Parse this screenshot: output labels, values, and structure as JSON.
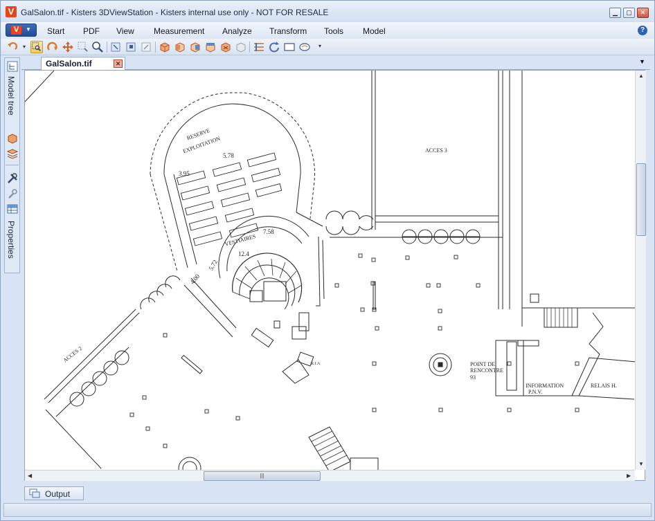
{
  "window": {
    "title": "GalSalon.tif - Kisters 3DViewStation - Kisters internal use only - NOT FOR RESALE",
    "logo_letter": "V"
  },
  "menu": {
    "items": [
      "Start",
      "PDF",
      "View",
      "Measurement",
      "Analyze",
      "Transform",
      "Tools",
      "Model"
    ],
    "help": "?"
  },
  "sidebar": {
    "model_tree_label": "Model tree",
    "properties_label": "Properties"
  },
  "document": {
    "tab_label": "GalSalon.tif"
  },
  "drawing": {
    "labels": {
      "reserve": "RESERVE",
      "exploitation": "EXPLOITATION",
      "dim_395": "3.95",
      "dim_578": "5.78",
      "vestiaires": "VESTIAIRES",
      "dim_758": "7.58",
      "dim_572": "5.72",
      "dim_124": "12.4",
      "dim_400": "4.00",
      "acces3": "ACCES 3",
      "acces2": "ACCES 2",
      "point_de": "POINT DE",
      "rencontre": "RENCONTRE",
      "num_93": "93",
      "information": "INFORMATION",
      "pnv": "P.N.V.",
      "relais": "RELAIS H.",
      "ria": "R.I.A"
    }
  },
  "output": {
    "label": "Output"
  },
  "colors": {
    "accent": "#e8431a",
    "chrome": "#d8e4f3"
  }
}
